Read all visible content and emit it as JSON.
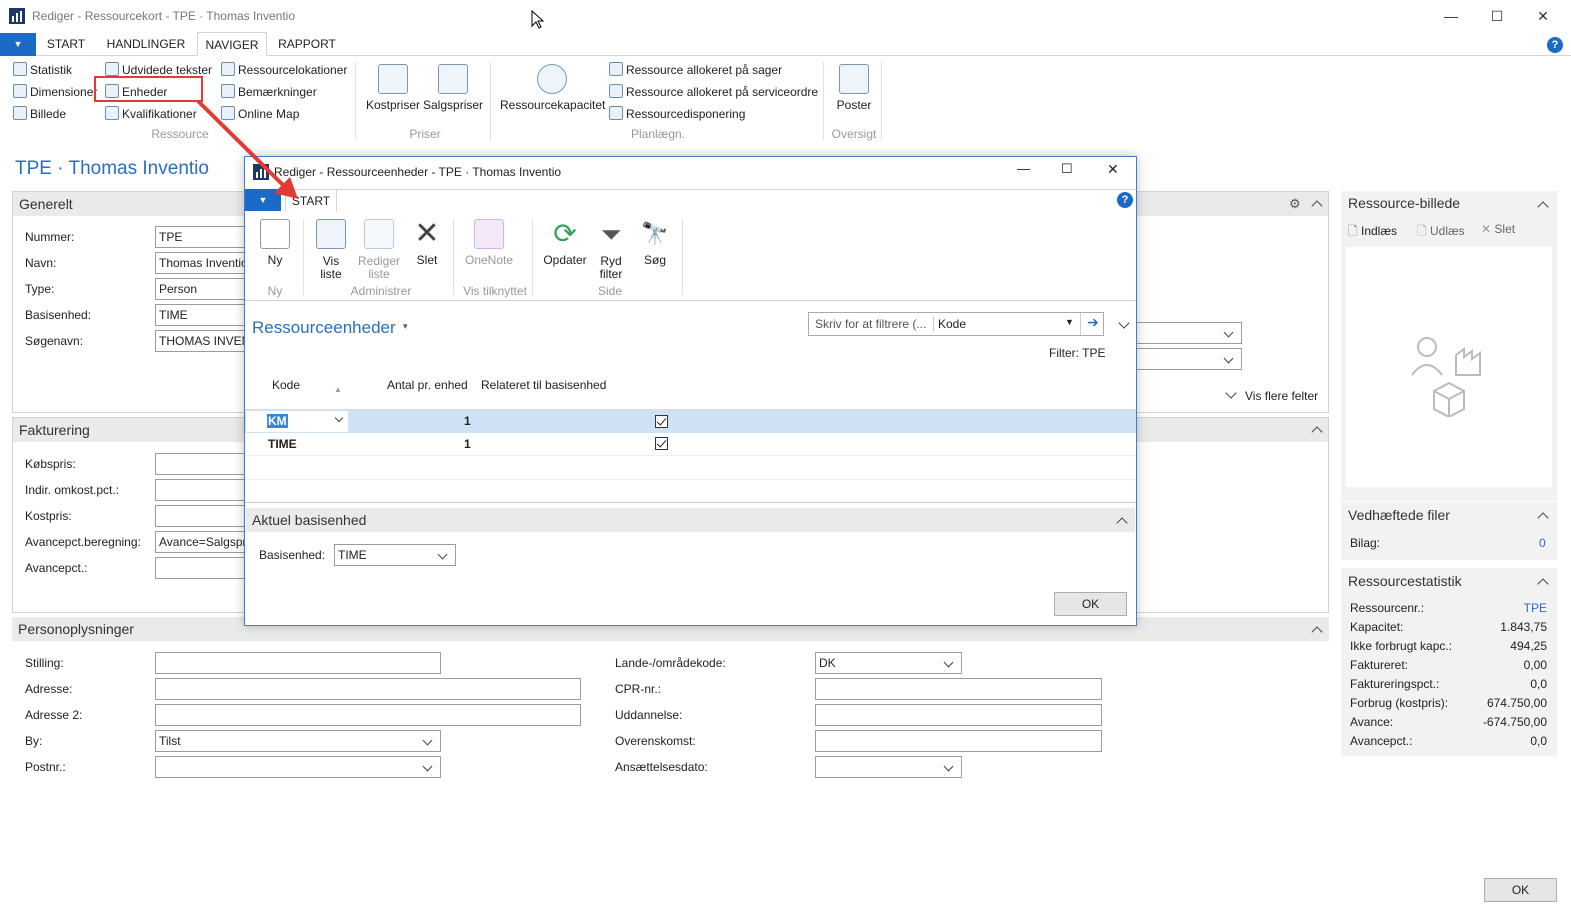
{
  "window": {
    "title": "Rediger - Ressourcekort - TPE · Thomas  Inventio",
    "minimize": "—",
    "maximize": "☐",
    "close": "✕"
  },
  "tabs": [
    "START",
    "HANDLINGER",
    "NAVIGER",
    "RAPPORT"
  ],
  "ribbon": {
    "ressource": {
      "items": [
        "Statistik",
        "Dimensioner",
        "Billede",
        "Udvidede tekster",
        "Enheder",
        "Kvalifikationer",
        "Ressourcelokationer",
        "Bemærkninger",
        "Online Map"
      ],
      "group": "Ressource"
    },
    "priser": {
      "items": [
        "Kostpriser",
        "Salgspriser"
      ],
      "group": "Priser"
    },
    "planlaegn": {
      "items": [
        "Ressourcekapacitet",
        "Ressource allokeret på sager",
        "Ressource allokeret på serviceordre",
        "Ressourcedisponering"
      ],
      "group": "Planlægn."
    },
    "oversigt": {
      "items": [
        "Poster"
      ],
      "group": "Oversigt"
    }
  },
  "page": {
    "title": "TPE · Thomas  Inventio"
  },
  "generelt": {
    "header": "Generelt",
    "nummer_label": "Nummer:",
    "nummer": "TPE",
    "navn_label": "Navn:",
    "navn": "Thomas  Inventio",
    "type_label": "Type:",
    "type": "Person",
    "basisenhed_label": "Basisenhed:",
    "basisenhed": "TIME",
    "soegenavn_label": "Søgenavn:",
    "soegenavn": "THOMAS INVENTIO",
    "vis_flere": "Vis flere felter"
  },
  "fakturering": {
    "header": "Fakturering",
    "labels": [
      "Købspris:",
      "Indir. omkost.pct.:",
      "Kostpris:",
      "Avancepct.beregning:",
      "Avancepct.:"
    ],
    "avancepct_beregning": "Avance=Salgspris-Kostpris"
  },
  "person": {
    "header": "Personoplysninger",
    "stilling": "Stilling:",
    "adresse": "Adresse:",
    "adresse2": "Adresse 2:",
    "by": "By:",
    "by_value": "Tilst",
    "postnr": "Postnr.:",
    "lande": "Lande-/områdekode:",
    "lande_value": "DK",
    "cpr": "CPR-nr.:",
    "uddannelse": "Uddannelse:",
    "overenskomst": "Overenskomst:",
    "ansaettelse": "Ansættelsesdato:"
  },
  "right": {
    "billede": {
      "header": "Ressource-billede",
      "indlaes": "Indlæs",
      "udlaes": "Udlæs",
      "slet": "Slet"
    },
    "filer": {
      "header": "Vedhæftede filer",
      "bilag_label": "Bilag:",
      "bilag": "0"
    },
    "statistik": {
      "header": "Ressourcestatistik",
      "rows": [
        [
          "Ressourcenr.:",
          "TPE"
        ],
        [
          "Kapacitet:",
          "1.843,75"
        ],
        [
          "Ikke forbrugt kapc.:",
          "494,25"
        ],
        [
          "Faktureret:",
          "0,00"
        ],
        [
          "Faktureringspct.:",
          "0,0"
        ],
        [
          "Forbrug (kostpris):",
          "674.750,00"
        ],
        [
          "Avance:",
          "-674.750,00"
        ],
        [
          "Avancepct.:",
          "0,0"
        ]
      ]
    }
  },
  "main_ok": "OK",
  "dialog": {
    "title": "Rediger - Ressourceenheder - TPE · Thomas  Inventio",
    "tab": "START",
    "buttons": {
      "ny": "Ny",
      "vis_liste_1": "Vis",
      "vis_liste_2": "liste",
      "rediger_1": "Rediger",
      "rediger_2": "liste",
      "slet": "Slet",
      "onenote": "OneNote",
      "opdater": "Opdater",
      "ryd_1": "Ryd",
      "ryd_2": "filter",
      "soeg": "Søg"
    },
    "groups": {
      "ny": "Ny",
      "administrer": "Administrer",
      "vis_tilknyttet": "Vis tilknyttet",
      "side": "Side"
    },
    "list_title": "Ressourceenheder",
    "filter_placeholder": "Skriv for at filtrere (...",
    "filter_field": "Kode",
    "filter_text": "Filter: TPE",
    "columns": [
      "Kode",
      "Antal pr. enhed",
      "Relateret til basisenhed"
    ],
    "rows": [
      {
        "kode": "KM",
        "antal": "1",
        "relateret": true
      },
      {
        "kode": "TIME",
        "antal": "1",
        "relateret": true
      }
    ],
    "factbox": {
      "header": "Aktuel basisenhed",
      "label": "Basisenhed:",
      "value": "TIME"
    },
    "ok": "OK"
  }
}
